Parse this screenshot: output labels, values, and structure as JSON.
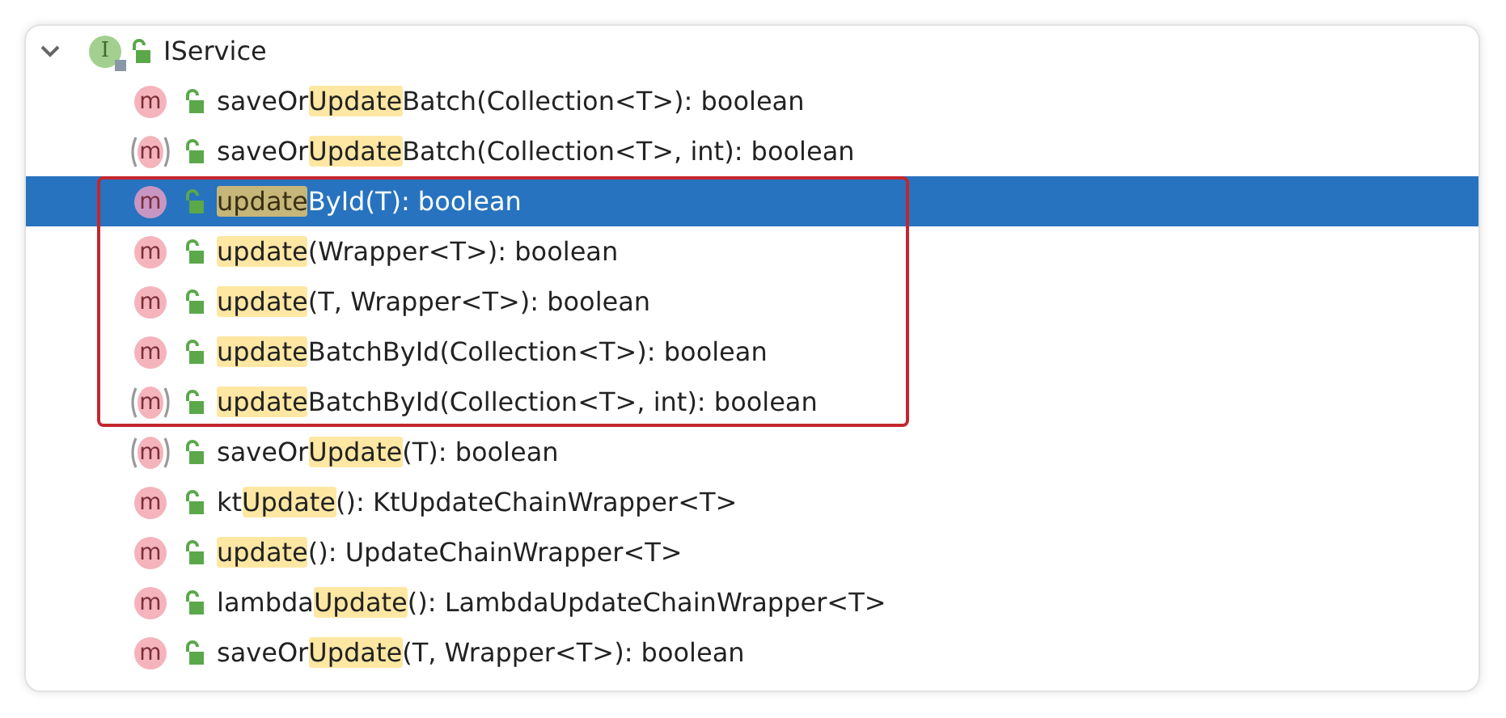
{
  "root": {
    "icon": "I",
    "label": "IService",
    "expanded": true
  },
  "methods": [
    {
      "kind": "method",
      "icon": "m",
      "before": "saveOr",
      "match": "Update",
      "after": "Batch(Collection<T>): boolean",
      "selected": false,
      "framed": false
    },
    {
      "kind": "overload",
      "icon": "m",
      "before": "saveOr",
      "match": "Update",
      "after": "Batch(Collection<T>, int): boolean",
      "selected": false,
      "framed": false
    },
    {
      "kind": "method",
      "icon": "m",
      "match": "update",
      "after": "ById(T): boolean",
      "selected": true,
      "framed": true
    },
    {
      "kind": "method",
      "icon": "m",
      "match": "update",
      "after": "(Wrapper<T>): boolean",
      "selected": false,
      "framed": true
    },
    {
      "kind": "method",
      "icon": "m",
      "match": "update",
      "after": "(T, Wrapper<T>): boolean",
      "selected": false,
      "framed": true
    },
    {
      "kind": "method",
      "icon": "m",
      "match": "update",
      "after": "BatchById(Collection<T>): boolean",
      "selected": false,
      "framed": true
    },
    {
      "kind": "overload",
      "icon": "m",
      "match": "update",
      "after": "BatchById(Collection<T>, int): boolean",
      "selected": false,
      "framed": true
    },
    {
      "kind": "overload",
      "icon": "m",
      "before": "saveOr",
      "match": "Update",
      "after": "(T): boolean",
      "selected": false,
      "framed": false
    },
    {
      "kind": "method",
      "icon": "m",
      "before": "kt",
      "match": "Update",
      "after": "(): KtUpdateChainWrapper<T>",
      "selected": false,
      "framed": false
    },
    {
      "kind": "method",
      "icon": "m",
      "match": "update",
      "after": "(): UpdateChainWrapper<T>",
      "selected": false,
      "framed": false
    },
    {
      "kind": "method",
      "icon": "m",
      "before": "lambda",
      "match": "Update",
      "after": "(): LambdaUpdateChainWrapper<T>",
      "selected": false,
      "framed": false
    },
    {
      "kind": "method",
      "icon": "m",
      "before": "saveOr",
      "match": "Update",
      "after": "(T, Wrapper<T>): boolean",
      "selected": false,
      "framed": false
    }
  ]
}
